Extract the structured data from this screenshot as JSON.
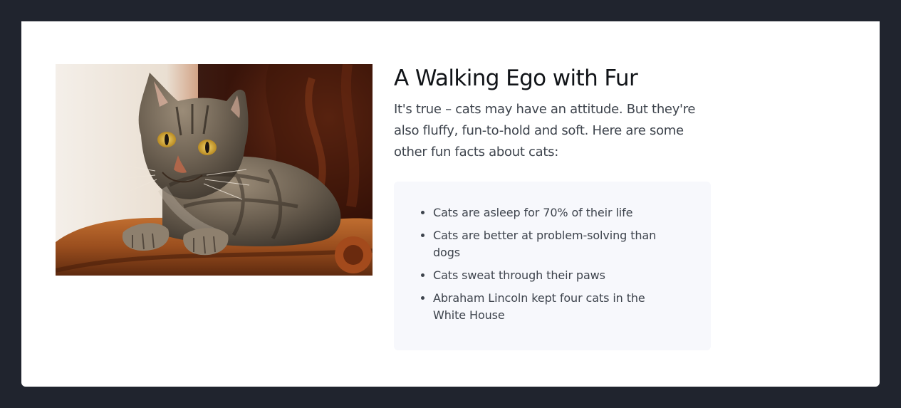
{
  "heading": "A Walking Ego with Fur",
  "intro": "It's true – cats may have an attitude. But they're also fluffy, fun-to-hold and soft. Here are some other fun facts about cats:",
  "facts": [
    "Cats are asleep for 70% of their life",
    "Cats are better at problem-solving than dogs",
    "Cats sweat through their paws",
    "Abraham Lincoln kept four cats in the White House"
  ]
}
